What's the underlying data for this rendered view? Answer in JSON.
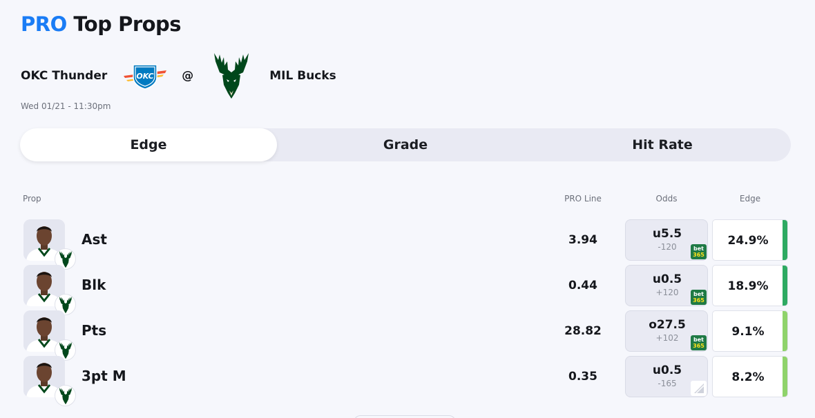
{
  "header": {
    "pro_label": "PRO",
    "title": "Top Props"
  },
  "game": {
    "away_team": "OKC Thunder",
    "away_logo_icon": "okc-thunder-logo-icon",
    "at_symbol": "@",
    "home_team": "MIL Bucks",
    "home_logo_icon": "milwaukee-bucks-logo-icon",
    "datetime": "Wed 01/21 - 11:30pm"
  },
  "tabs": [
    {
      "label": "Edge",
      "active": true
    },
    {
      "label": "Grade",
      "active": false
    },
    {
      "label": "Hit Rate",
      "active": false
    }
  ],
  "columns": {
    "prop": "Prop",
    "pro_line": "PRO Line",
    "odds": "Odds",
    "edge": "Edge"
  },
  "props": [
    {
      "prop": "Ast",
      "pro_line": "3.94",
      "odds_line": "u5.5",
      "odds_price": "-120",
      "book_icon": "bet365-logo-icon",
      "edge": "24.9%",
      "edge_color": "#2eaa62"
    },
    {
      "prop": "Blk",
      "pro_line": "0.44",
      "odds_line": "u0.5",
      "odds_price": "+120",
      "book_icon": "bet365-logo-icon",
      "edge": "18.9%",
      "edge_color": "#2eaa62"
    },
    {
      "prop": "Pts",
      "pro_line": "28.82",
      "odds_line": "o27.5",
      "odds_price": "+102",
      "book_icon": "bet365-logo-icon",
      "edge": "9.1%",
      "edge_color": "#8fd36b"
    },
    {
      "prop": "3pt M",
      "pro_line": "0.35",
      "odds_line": "u0.5",
      "odds_price": "-165",
      "book_icon": "sportsbook-logo-icon",
      "edge": "8.2%",
      "edge_color": "#8fd36b"
    }
  ],
  "bet365_text": {
    "top": "bet",
    "bottom": "365"
  }
}
